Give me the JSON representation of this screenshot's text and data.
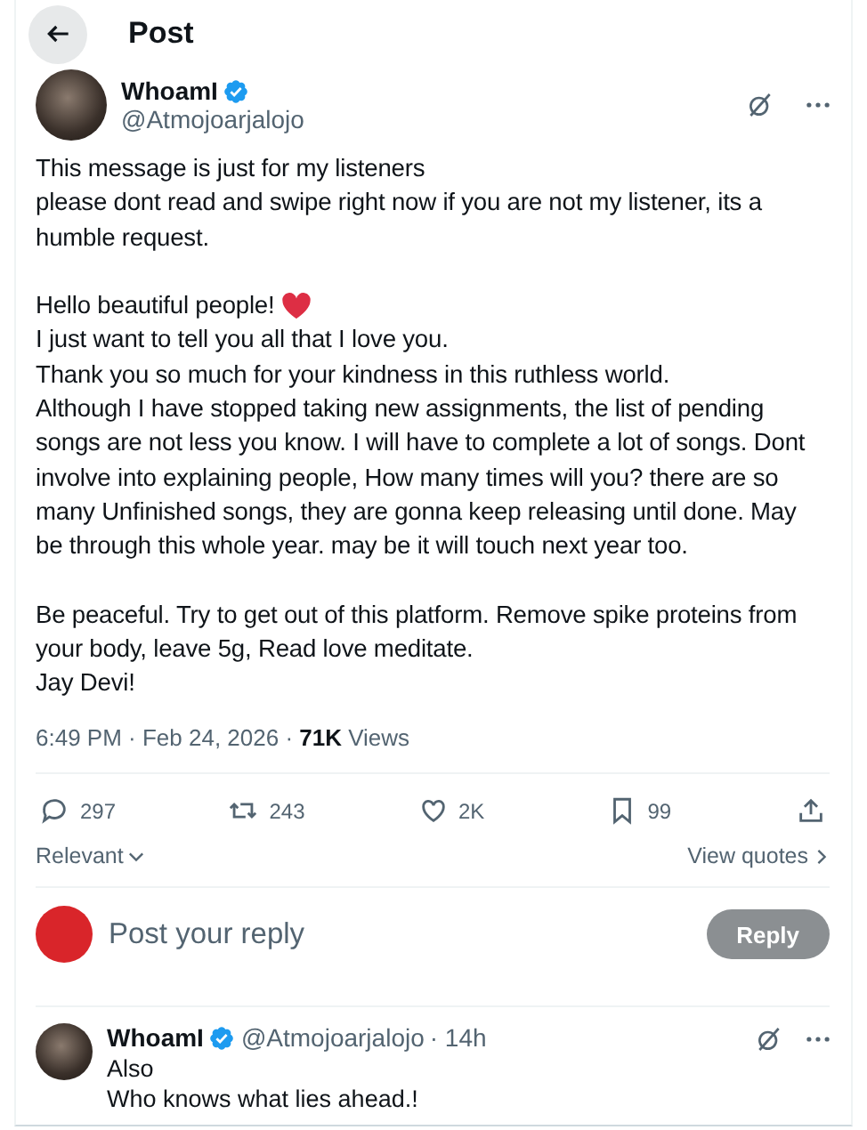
{
  "header": {
    "title": "Post"
  },
  "post": {
    "name": "WhoamI",
    "handle": "@Atmojoarjalojo",
    "verified": true,
    "paragraphs": [
      {
        "lines": [
          {
            "text": "This message is just for my listeners"
          },
          {
            "text": "please dont read and swipe right now if you are not my listener, its a humble request."
          }
        ]
      },
      {
        "lines": [
          {
            "text": "Hello beautiful people!",
            "heart": true
          },
          {
            "text": "I just want to tell you all that I love you."
          },
          {
            "text": "Thank you so much for your kindness in this ruthless world."
          },
          {
            "text": "Although I have stopped taking new assignments, the list of pending songs are not less you know. I will have to complete a lot of songs. Dont involve into explaining people, How many times will you? there are so many Unfinished songs, they are gonna keep releasing until done. May be through this whole year. may be it will touch next year too."
          }
        ]
      },
      {
        "lines": [
          {
            "text": "Be peaceful. Try to get out of this platform. Remove spike proteins from your body, leave 5g, Read love meditate."
          },
          {
            "text": "Jay Devi!"
          }
        ]
      }
    ],
    "meta": "6:49 PM · Feb 24, 2026 · **71K** Views",
    "actions": [
      {
        "kind": "reply",
        "count": "297"
      },
      {
        "kind": "repost",
        "count": "243"
      },
      {
        "kind": "like",
        "count": "2K"
      },
      {
        "kind": "bookmark",
        "count": "99"
      },
      {
        "kind": "share"
      }
    ]
  },
  "sort": {
    "label": "Relevant",
    "quotes": "View quotes"
  },
  "composer": {
    "placeholder": "Post your reply",
    "button": "Reply",
    "disabled": true
  },
  "replies": [
    {
      "name": "WhoamI",
      "handle": "@Atmojoarjalojo",
      "time": "· 14h",
      "verified": true,
      "lines": [
        "Also",
        "Who knows what lies ahead.!"
      ]
    }
  ]
}
